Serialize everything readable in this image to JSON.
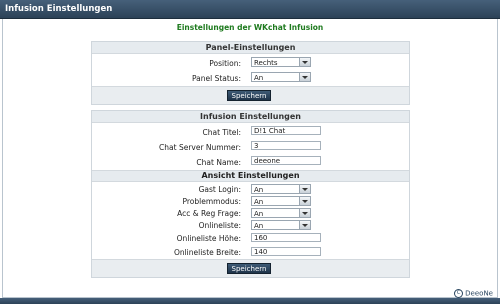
{
  "window": {
    "title": "Infusion Einstellungen"
  },
  "subtitle": "Einstellungen der WKchat Infusion",
  "panel_settings": {
    "heading": "Panel-Einstellungen",
    "position": {
      "label": "Position:",
      "value": "Rechts"
    },
    "status": {
      "label": "Panel Status:",
      "value": "An"
    },
    "save_label": "Speichern"
  },
  "infusion_settings": {
    "heading": "Infusion Einstellungen",
    "chat_title": {
      "label": "Chat Titel:",
      "value": "D!1 Chat"
    },
    "server_number": {
      "label": "Chat Server Nummer:",
      "value": "3"
    },
    "chat_name": {
      "label": "Chat Name:",
      "value": "deeone"
    }
  },
  "view_settings": {
    "heading": "Ansicht Einstellungen",
    "guest_login": {
      "label": "Gast Login:",
      "value": "An"
    },
    "problem_mode": {
      "label": "Problemmodus:",
      "value": "An"
    },
    "acc_reg": {
      "label": "Acc & Reg Frage:",
      "value": "An"
    },
    "online_list": {
      "label": "Onlineliste:",
      "value": "An"
    },
    "online_height": {
      "label": "Onlineliste Höhe:",
      "value": "160"
    },
    "online_width": {
      "label": "Onlineliste Breite:",
      "value": "140"
    },
    "save_label": "Speichern"
  },
  "footer": {
    "copyright_symbol": "C",
    "text": "DeeoNe"
  }
}
